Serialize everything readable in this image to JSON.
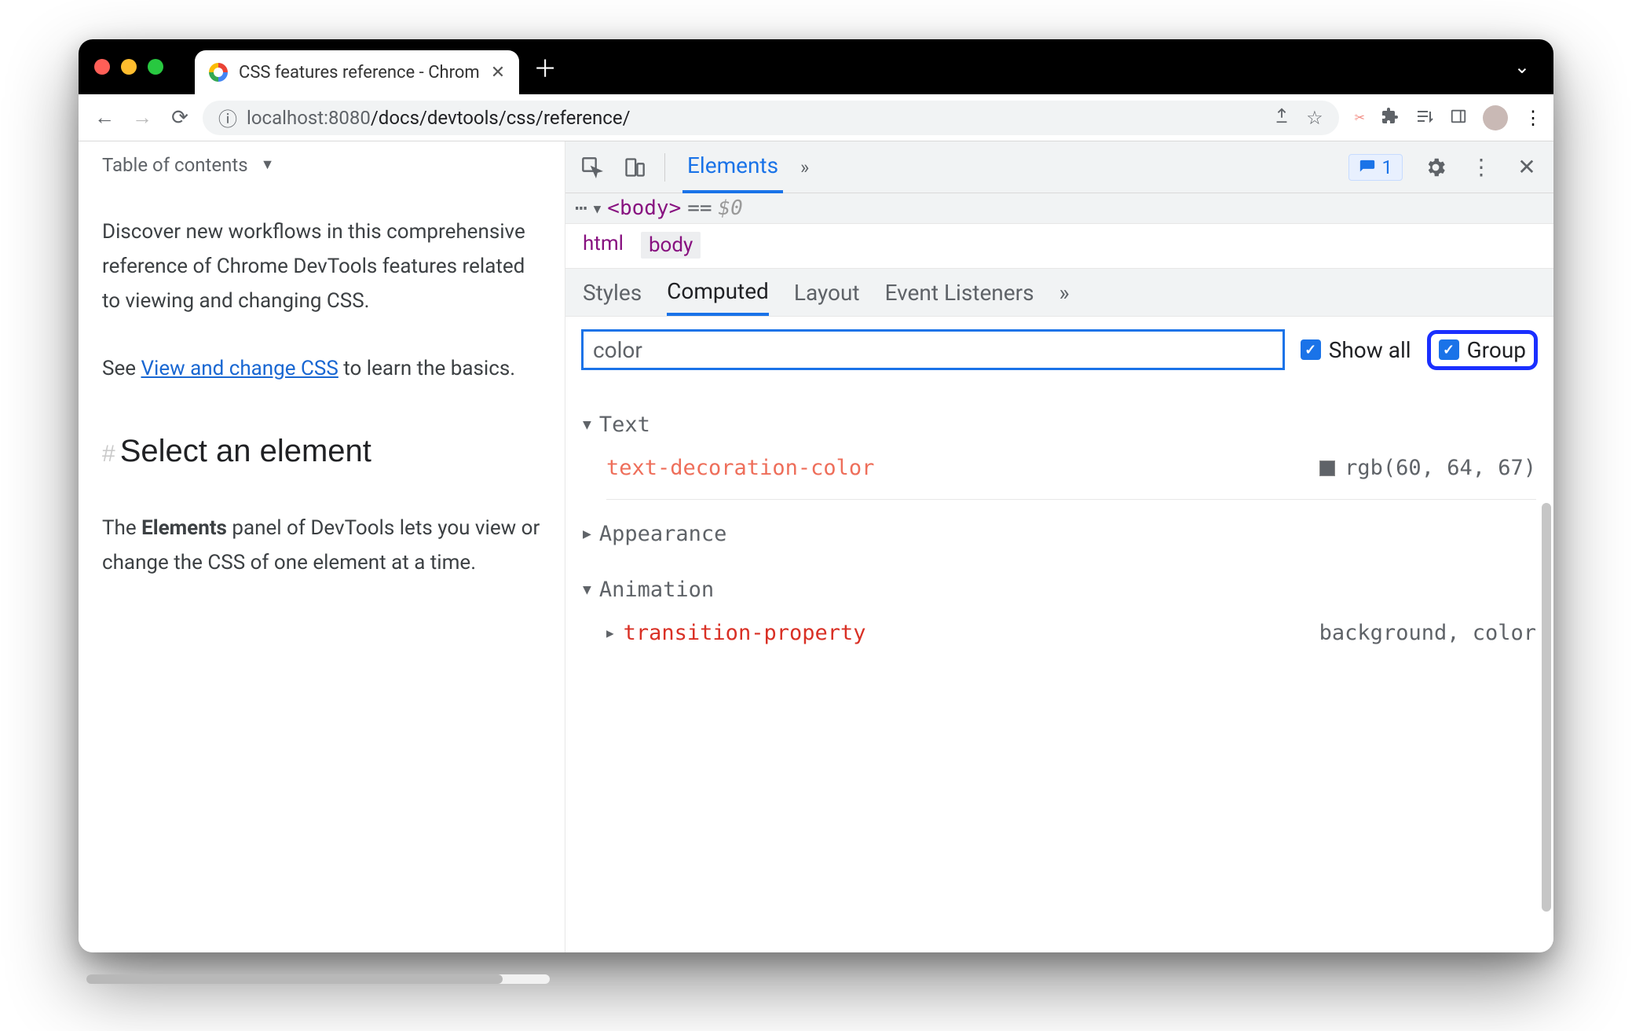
{
  "tab": {
    "title": "CSS features reference - Chrom"
  },
  "toolbar": {
    "url_host": "localhost",
    "url_port": ":8080",
    "url_path": "/docs/devtools/css/reference/"
  },
  "page": {
    "toc_label": "Table of contents",
    "p1": "Discover new workflows in this comprehensive reference of Chrome DevTools features related to viewing and changing CSS.",
    "p2_pre": "See ",
    "p2_link": "View and change CSS",
    "p2_post": " to learn the basics.",
    "h2": "Select an element",
    "p3_pre": "The ",
    "p3_bold": "Elements",
    "p3_post": " panel of DevTools lets you view or change the CSS of one element at a time."
  },
  "devtools": {
    "tabs": {
      "elements": "Elements"
    },
    "issues_count": "1",
    "dom": {
      "tag": "<body>",
      "eq": " == ",
      "dollar": "$0"
    },
    "breadcrumb": {
      "html": "html",
      "body": "body"
    },
    "panels": {
      "styles": "Styles",
      "computed": "Computed",
      "layout": "Layout",
      "listeners": "Event Listeners"
    },
    "filter": {
      "value": "color",
      "show_all": "Show all",
      "group": "Group"
    },
    "groups": {
      "g1": {
        "label": "Text",
        "prop": "text-decoration-color",
        "val": "rgb(60, 64, 67)"
      },
      "g2": {
        "label": "Appearance"
      },
      "g3": {
        "label": "Animation",
        "prop": "transition-property",
        "val": "background, color"
      }
    }
  }
}
